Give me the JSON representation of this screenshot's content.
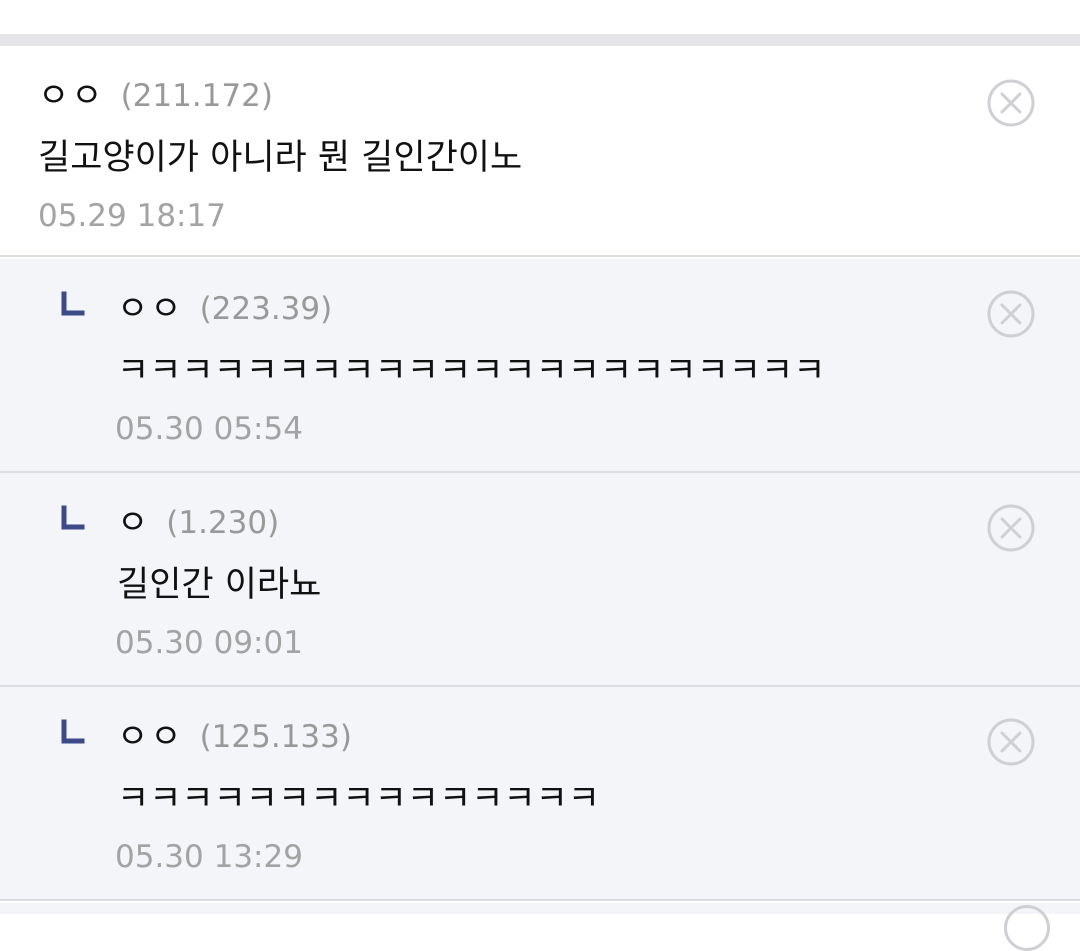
{
  "comments": [
    {
      "nickname": "ㅇㅇ",
      "ip": "(211.172)",
      "text": "길고양이가 아니라 뭔 길인간이노",
      "date": "05.29 18:17",
      "is_reply": false
    },
    {
      "nickname": "ㅇㅇ",
      "ip": "(223.39)",
      "text": "ㅋㅋㅋㅋㅋㅋㅋㅋㅋㅋㅋㅋㅋㅋㅋㅋㅋㅋㅋㅋㅋㅋ",
      "date": "05.30 05:54",
      "is_reply": true
    },
    {
      "nickname": "ㅇ",
      "ip": "(1.230)",
      "text": "길인간 이라뇨",
      "date": "05.30 09:01",
      "is_reply": true
    },
    {
      "nickname": "ㅇㅇ",
      "ip": "(125.133)",
      "text": "ㅋㅋㅋㅋㅋㅋㅋㅋㅋㅋㅋㅋㅋㅋㅋ",
      "date": "05.30 13:29",
      "is_reply": true
    }
  ],
  "icons": {
    "reply": "reply-arrow-icon",
    "delete": "delete-circle-x-icon"
  },
  "colors": {
    "reply_arrow": "#3d4a8a",
    "reply_background": "#f4f5f8",
    "meta_text": "#a3a3a3",
    "delete_icon": "#d0d0d4"
  }
}
